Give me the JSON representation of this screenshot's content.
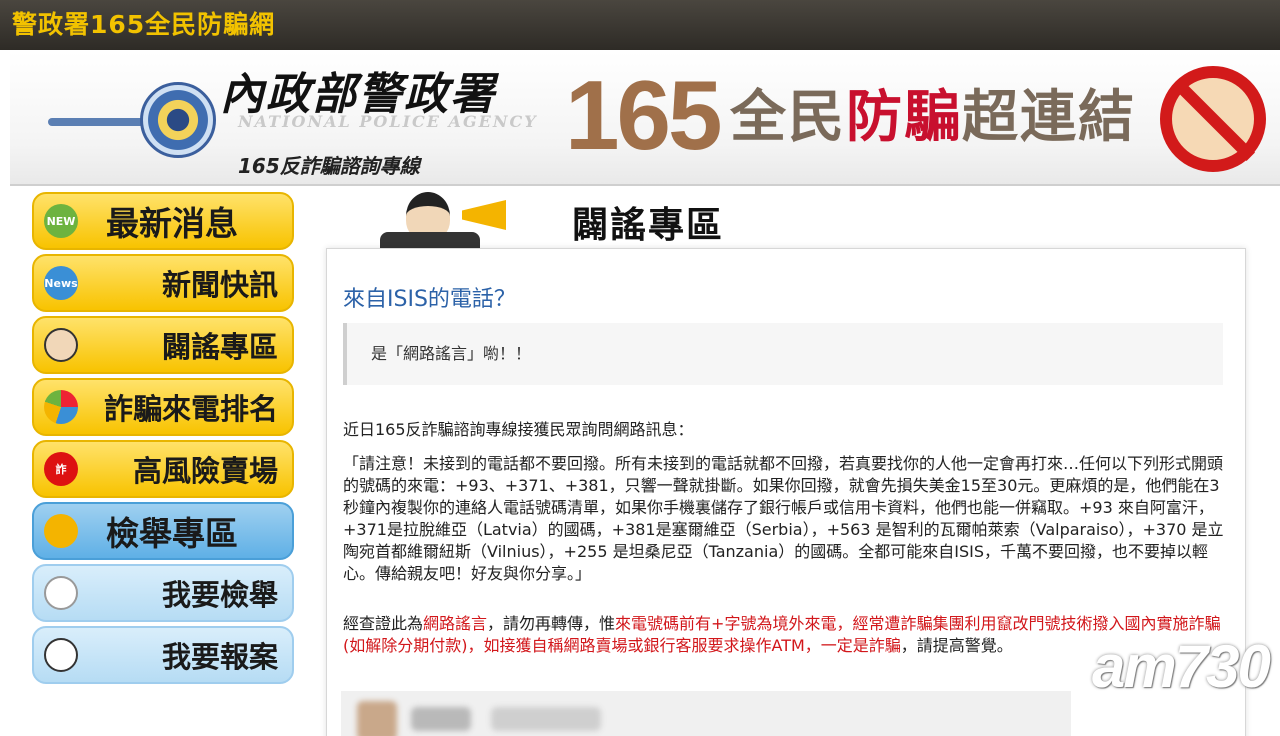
{
  "titlebar": {
    "title": "警政署165全民防騙網"
  },
  "banner": {
    "agency_name": "內政部警政署",
    "agency_en": "NATIONAL POLICE AGENCY",
    "agency_sub": "165反詐騙諮詢專線",
    "number": "165",
    "slogan_pre": "全民",
    "slogan_red": "防騙",
    "slogan_post": "超連結"
  },
  "sidebar": {
    "items": [
      {
        "icon": "NEW",
        "label": "最新消息"
      },
      {
        "icon": "News",
        "label": "新聞快訊"
      },
      {
        "icon": "",
        "label": "闢謠專區"
      },
      {
        "icon": "",
        "label": "詐騙來電排名"
      },
      {
        "icon": "詐",
        "label": "高風險賣場"
      },
      {
        "icon": "",
        "label": "檢舉專區"
      },
      {
        "icon": "✉",
        "label": "我要檢舉"
      },
      {
        "icon": "✔",
        "label": "我要報案"
      }
    ]
  },
  "content": {
    "zone_title": "闢謠專區",
    "article_title": "來自ISIS的電話？",
    "quote": "是「網路謠言」喲！！",
    "p1": "近日165反詐騙諮詢專線接獲民眾詢問網路訊息：",
    "p2": "「請注意！未接到的電話都不要回撥。所有未接到的電話就都不回撥，若真要找你的人他一定會再打來…任何以下列形式開頭的號碼的來電：+93、+371、+381，只響一聲就掛斷。如果你回撥，就會先損失美金15至30元。更麻煩的是，他們能在3秒鐘內複製你的連絡人電話號碼清單，如果你手機裏儲存了銀行帳戶或信用卡資料，他們也能一併竊取。+93 來自阿富汗，+371是拉脫維亞（Latvia）的國碼，+381是塞爾維亞（Serbia），+563 是智利的瓦爾帕萊索（Valparaiso），+370 是立陶宛首都維爾紐斯（Vilnius），+255 是坦桑尼亞（Tanzania）的國碼。全都可能來自ISIS，千萬不要回撥，也不要掉以輕心。傳給親友吧！好友與你分享。」",
    "p3_a": "經查證此為",
    "p3_red1": "網路謠言",
    "p3_b": "，請勿再轉傳，惟",
    "p3_red2": "來電號碼前有+字號為境外來電，經常遭詐騙集團利用竄改門號技術撥入國內實施詐騙(如解除分期付款)，如接獲自稱網路賣場或銀行客服要求操作ATM，一定是詐騙",
    "p3_c": "，請提高警覺。"
  },
  "watermark": {
    "text": "am730"
  },
  "colors": {
    "titlebar_text": "#f2c200",
    "link_blue": "#2c62a8",
    "alert_red": "#d2171b",
    "nav_yellow": "#f8c300",
    "nav_blue": "#5fb0e6"
  }
}
